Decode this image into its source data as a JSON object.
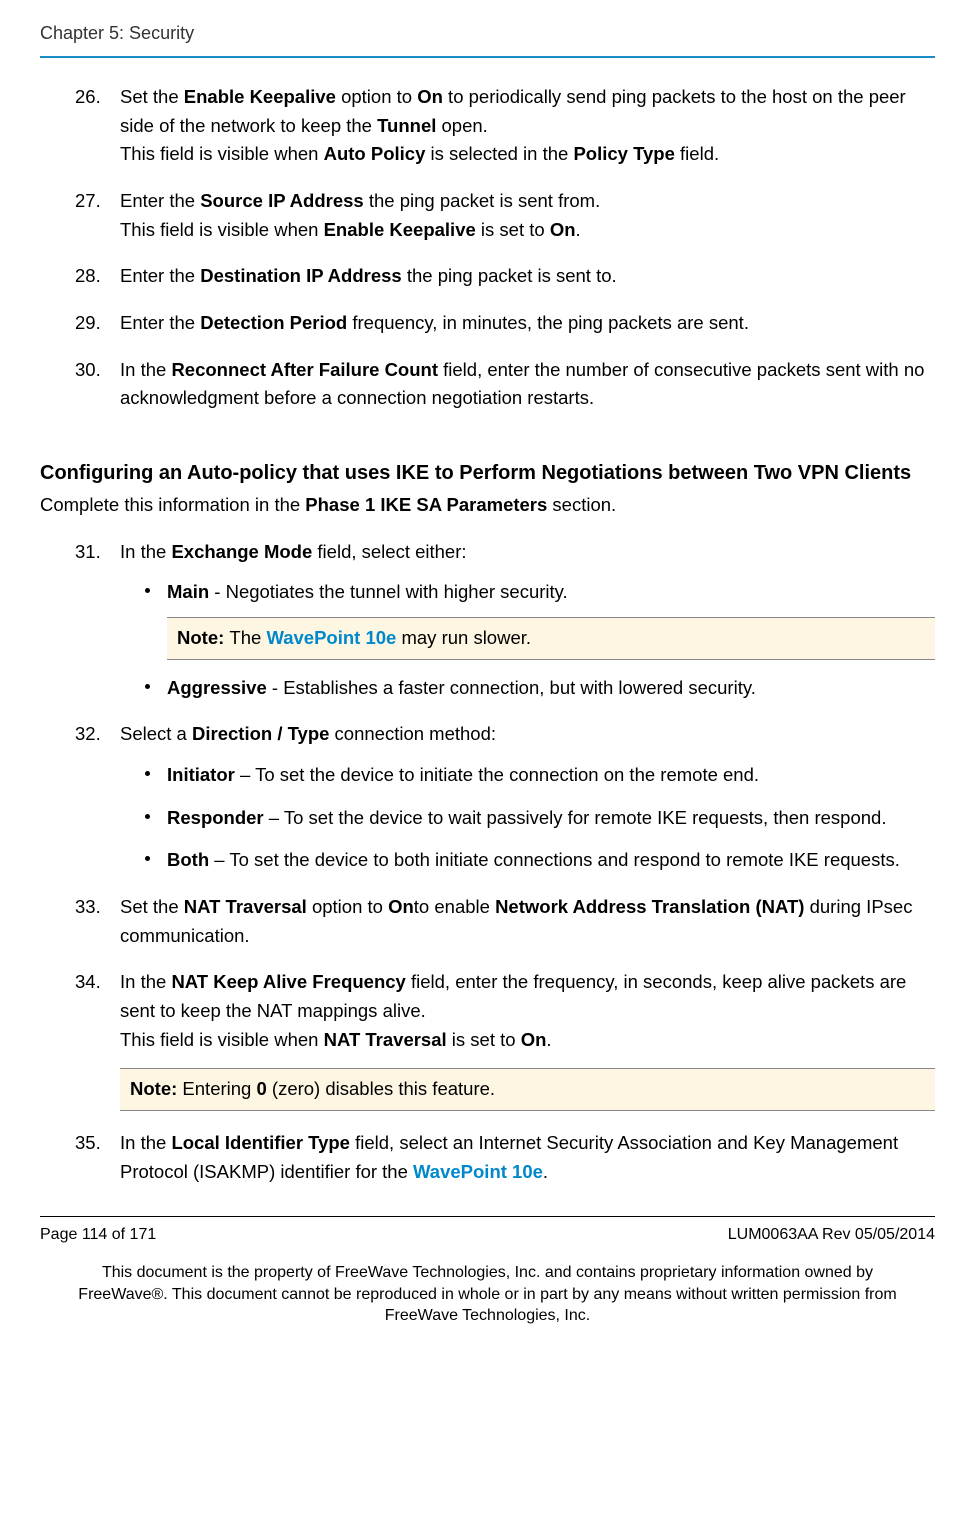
{
  "header": "Chapter 5: Security",
  "brand": "WavePoint 10e",
  "steps1": {
    "26": {
      "pre1": "Set the ",
      "b1": "Enable Keepalive",
      "mid1": " option to ",
      "b2": "On",
      "mid2": " to periodically send ping packets to the host on the peer side of the network to keep the ",
      "b3": "Tunnel",
      "post1": " open.",
      "line2_pre": "This field is visible when ",
      "line2_b1": "Auto Policy",
      "line2_mid": " is selected in the ",
      "line2_b2": "Policy Type",
      "line2_post": " field."
    },
    "27": {
      "pre": "Enter the ",
      "b1": "Source IP Address",
      "post": " the ping packet is sent from.",
      "line2_pre": "This field is visible when ",
      "line2_b1": "Enable Keepalive",
      "line2_mid": " is set to ",
      "line2_b2": "On",
      "line2_post": "."
    },
    "28": {
      "pre": "Enter the ",
      "b1": "Destination IP Address",
      "post": " the ping packet is sent to."
    },
    "29": {
      "pre": "Enter the ",
      "b1": "Detection Period",
      "post": " frequency, in minutes, the ping packets are sent."
    },
    "30": {
      "pre": "In the ",
      "b1": "Reconnect After Failure Count ",
      "post": " field, enter the number of consecutive packets sent with no acknowledgment before a connection negotiation restarts."
    }
  },
  "section_heading": "Configuring an Auto-policy that uses IKE to Perform Negotiations between Two VPN Clients",
  "section_intro_pre": "Complete this information in the ",
  "section_intro_b": "Phase 1 IKE SA Parameters",
  "section_intro_post": " section.",
  "steps2": {
    "31": {
      "pre": "In the ",
      "b1": "Exchange Mode",
      "post": " field, select either:",
      "sub": [
        {
          "b": "Main",
          "t": " - Negotiates the tunnel with higher security."
        },
        {
          "b": "Aggressive",
          "t": " - Establishes a faster connection, but with lowered security."
        }
      ],
      "note_pre": "Note: ",
      "note_mid": "The ",
      "note_post": " may run slower."
    },
    "32": {
      "pre": "Select a ",
      "b1": "Direction / Type",
      "post": " connection method:",
      "sub": [
        {
          "b": "Initiator",
          "t": " – To set the device to initiate the connection on the remote end."
        },
        {
          "b": "Responder",
          "t": " – To set the device to wait passively for remote IKE requests, then respond."
        },
        {
          "b": "Both",
          "t": " – To set the device to both initiate connections and respond to remote IKE requests."
        }
      ]
    },
    "33": {
      "pre": "Set the ",
      "b1": "NAT Traversal ",
      "mid": " option to ",
      "b2": "On",
      "mid2": "to enable ",
      "b3": "Network Address Translation (NAT)",
      "post": " during IPsec communication."
    },
    "34": {
      "pre": "In the ",
      "b1": "NAT Keep Alive Frequency",
      "post": " field, enter the frequency, in seconds, keep alive packets are sent to keep the NAT mappings alive.",
      "line2_pre": "This field is visible when ",
      "line2_b1": "NAT Traversal",
      "line2_mid": " is set to ",
      "line2_b2": "On",
      "line2_post": ".",
      "note_pre": "Note: ",
      "note_mid": "Entering ",
      "note_b": "0",
      "note_post": " (zero) disables this feature."
    },
    "35": {
      "pre": "In the ",
      "b1": "Local Identifier Type",
      "mid": " field, select an Internet Security Association and Key Management Protocol (ISAKMP) identifier for the ",
      "post": "."
    }
  },
  "footer": {
    "left": "Page 114 of 171",
    "right": "LUM0063AA Rev 05/05/2014",
    "text": "This document is the property of FreeWave Technologies, Inc. and contains proprietary information owned by FreeWave®. This document cannot be reproduced in whole or in part by any means without written permission from FreeWave Technologies, Inc."
  }
}
